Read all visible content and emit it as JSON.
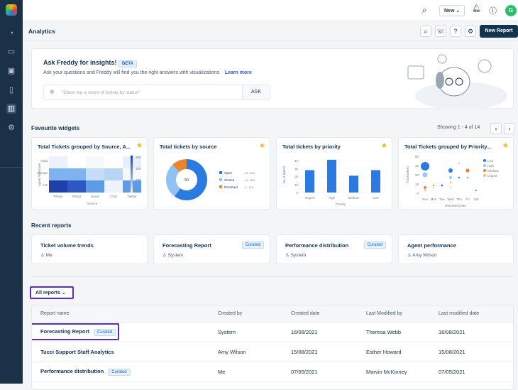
{
  "colors": {
    "sidebar": "#1b3147",
    "accent": "#2c5cc5",
    "highlight": "#5b2dc8",
    "star": "#f2b90c"
  },
  "topbar": {
    "new_label": "New",
    "avatar": "G"
  },
  "header": {
    "title": "Analytics",
    "new_report": "New Report"
  },
  "freddy": {
    "title": "Ask Freddy for insights!",
    "badge": "BETA",
    "description": "Ask your questions and Freddy will find you the right answers with visualizations.",
    "learn_more": "Learn more",
    "placeholder": "\"Show me a count of tickets by status\"",
    "ask": "ASK"
  },
  "favourites": {
    "title": "Favourite widgets",
    "pagination": "Showing 1 - 4 of 14",
    "widgets": [
      {
        "title": "Total Tickets grouped by Source, A...",
        "chart_data": {
          "type": "heatmap",
          "xlabel": "Source",
          "ylabel": "Agent Timezone",
          "x": [
            "Phone",
            "Portal",
            "Email",
            "Chat",
            "Twitter"
          ],
          "y": [
            "India",
            "Europe",
            "US"
          ],
          "colorbar_ticks": [
            "200",
            "150",
            "100",
            "0"
          ]
        }
      },
      {
        "title": "Total tickets by source",
        "chart_data": {
          "type": "pie",
          "center_label": "50",
          "legend": [
            {
              "label": "Open",
              "detail": "- 30 - 60%",
              "color": "#2a7ae2"
            },
            {
              "label": "Closed",
              "detail": "- 14 - 28%",
              "color": "#8fc1f3"
            },
            {
              "label": "Resolved",
              "detail": "- 6 - 12%",
              "color": "#e8852f"
            }
          ],
          "values": [
            30,
            14,
            6
          ]
        }
      },
      {
        "title": "Total tickets by priority",
        "chart_data": {
          "type": "bar",
          "categories": [
            "Urgent",
            "High",
            "Medium",
            "Low"
          ],
          "values": [
            28,
            41,
            21,
            28
          ],
          "xlabel": "Priority",
          "ylabel": "No.of tickets",
          "yticks": [
            "40",
            "30",
            "20",
            "10",
            "0"
          ],
          "ylim": [
            0,
            40
          ]
        }
      },
      {
        "title": "Total Tickets grouped by Priority...",
        "chart_data": {
          "type": "scatter",
          "xlabel": "Resolved Date",
          "ylabel": "Total tickets",
          "x": [
            "Sun",
            "Mon",
            "Tue",
            "Wed",
            "Thu",
            "Fri",
            "Sat"
          ],
          "yticks": [
            "60",
            "45",
            "30",
            "15",
            "0"
          ],
          "legend": [
            {
              "label": "Low",
              "color": "#2a7ae2"
            },
            {
              "label": "High",
              "color": "#9cc8f5"
            },
            {
              "label": "Medium",
              "color": "#e8852f"
            },
            {
              "label": "Urgent",
              "color": "#f3c28f"
            }
          ]
        }
      }
    ]
  },
  "recent": {
    "title": "Recent reports",
    "items": [
      {
        "name": "Ticket volume trends",
        "owner": "Me",
        "badge": ""
      },
      {
        "name": "Forecasting Report",
        "owner": "System",
        "badge": "Curated"
      },
      {
        "name": "Performance distribution",
        "owner": "System",
        "badge": "Curated"
      },
      {
        "name": "Agent performance",
        "owner": "Amy Wilson",
        "badge": ""
      }
    ]
  },
  "all_reports": {
    "filter": "All reports",
    "columns": [
      "Report name",
      "Created by",
      "Created date",
      "Last Modified by",
      "Last modified date"
    ],
    "rows": [
      {
        "name": "Forecasting Report",
        "badge": "Curated",
        "created_by": "System",
        "created": "16/08/2021",
        "modified_by": "Theresa Webb",
        "modified": "16/08/2021"
      },
      {
        "name": "Tucci Support Staff Analytics",
        "badge": "",
        "created_by": "Amy Wilson",
        "created": "15/08/2021",
        "modified_by": "Esther Howard",
        "modified": "15/08/2021"
      },
      {
        "name": "Performance distribution",
        "badge": "Curated",
        "created_by": "Me",
        "created": "07/05/2021",
        "modified_by": "Marvin McKinney",
        "modified": "07/05/2021"
      }
    ]
  }
}
